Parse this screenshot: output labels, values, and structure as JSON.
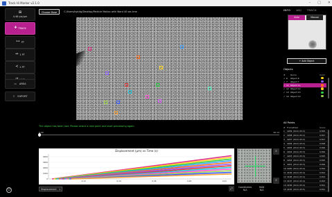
{
  "window": {
    "title": "Track Hi Marker v2.1.0",
    "controls": [
      "–",
      "□",
      "✕"
    ]
  },
  "left_toolbar": {
    "fps": "4.48 pix/µm",
    "buttons": [
      {
        "label": "TRACK",
        "icon": "plus-icon",
        "glyph": "✚",
        "active": true
      },
      {
        "label": "PT",
        "icon": "dots-icon",
        "glyph": "••",
        "active": false
      },
      {
        "label": "1 PT",
        "icon": "arrow-icon",
        "glyph": "↔",
        "active": false
      },
      {
        "label": "2 PT",
        "icon": "share-icon",
        "glyph": "≺",
        "active": false
      },
      {
        "label": "LINE",
        "icon": "line-icon",
        "glyph": "⇄",
        "active": false
      },
      {
        "label": "AREA",
        "icon": "area-icon",
        "glyph": "▭",
        "active": false
      }
    ],
    "export_label": "EXPORT"
  },
  "topbar": {
    "choose_label": "Choose Dose",
    "file_path": "C:/Users/kgh/tg/Desktop/Particle Motion with Ward 40 sec.tme"
  },
  "status": {
    "message": "The object has been lost. Please select a new point and start processing again.",
    "timeline_start": "0.00",
    "timeline_end": "40.13"
  },
  "markers": [
    {
      "color": "#e0308a"
    },
    {
      "color": "#3aa0ff"
    },
    {
      "color": "#ff6a1a"
    },
    {
      "color": "#8a5cff"
    },
    {
      "color": "#ffd21a"
    },
    {
      "color": "#2ecf4a"
    },
    {
      "color": "#e03a3a"
    },
    {
      "color": "#22c8d8"
    },
    {
      "color": "#ff4fd0"
    },
    {
      "color": "#9ad14a"
    },
    {
      "color": "#3a5cff"
    },
    {
      "color": "#ffa43a"
    },
    {
      "color": "#d45aff"
    },
    {
      "color": "#5affc8"
    }
  ],
  "chart_data": {
    "type": "line",
    "title": "Displacement (µm) vs Time (s)",
    "xlabel": "",
    "ylabel": "",
    "xlim": [
      0,
      0.21
    ],
    "ylim": [
      0,
      4500
    ],
    "x_ticks": [
      "0",
      "0.06",
      "0.12",
      "0.18",
      "0.24",
      "0.30",
      "0.36"
    ],
    "x_ticks_shown": [
      "0.12",
      "0.24",
      "0.36",
      "0.48",
      "0.21"
    ],
    "y_ticks": [
      "0",
      "1000",
      "2000",
      "3000",
      "4000"
    ],
    "series": [
      {
        "color": "#e0308a",
        "values": [
          0,
          4200
        ]
      },
      {
        "color": "#ffd21a",
        "values": [
          0,
          3900
        ]
      },
      {
        "color": "#2ecf4a",
        "values": [
          0,
          3600
        ]
      },
      {
        "color": "#3aa0ff",
        "values": [
          0,
          3300
        ]
      },
      {
        "color": "#ff6a1a",
        "values": [
          0,
          3000
        ]
      },
      {
        "color": "#8a5cff",
        "values": [
          0,
          2700
        ]
      },
      {
        "color": "#e03a3a",
        "values": [
          0,
          2400
        ]
      },
      {
        "color": "#22c8d8",
        "values": [
          0,
          2100
        ]
      },
      {
        "color": "#ff4fd0",
        "values": [
          0,
          1800
        ]
      },
      {
        "color": "#9ad14a",
        "values": [
          0,
          1500
        ]
      },
      {
        "color": "#3a5cff",
        "values": [
          0,
          1200
        ]
      },
      {
        "color": "#ffa43a",
        "values": [
          0,
          900
        ]
      }
    ]
  },
  "graph_controls": {
    "plot_select": "Displacement",
    "coordinates_label": "Coordinates",
    "coordinates_value": "N/A",
    "raw_label": "RAW",
    "raw_value": "N/A"
  },
  "right_panel": {
    "tabs": [
      "INFO",
      "ADJ",
      "TRACK"
    ],
    "mode_auto": "Auto",
    "mode_manual": "Manual",
    "add_object_label": "+ Add Object",
    "objects_title": "Objects",
    "objects_headers": [
      "#",
      "",
      "Name",
      "Color"
    ],
    "objects": [
      {
        "id": "6",
        "name": "Object 6",
        "color": "#ffd21a",
        "selected": false
      },
      {
        "id": "7",
        "name": "Object 7",
        "color": "#8a5cff",
        "selected": false
      },
      {
        "id": "11",
        "name": "Object 11",
        "color": "#ff6a1a",
        "selected": true
      },
      {
        "id": "12",
        "name": "Object 12",
        "color": "#ffd21a",
        "selected": false
      },
      {
        "id": "13",
        "name": "Object 13",
        "color": "#2ecf4a",
        "selected": false
      },
      {
        "id": "10",
        "name": "Object 10",
        "color": "#9ad14a",
        "selected": false
      }
    ],
    "points_title": "All Points",
    "points_headers": [
      "#",
      "Frame",
      "Pixel",
      "Score"
    ],
    "points": [
      {
        "n": "1",
        "frame": "4209",
        "pixel": "(94.0, 63.2)",
        "score": "0.815"
      },
      {
        "n": "2",
        "frame": "4208",
        "pixel": "(94.0, 63.2)",
        "score": "0.817"
      },
      {
        "n": "3",
        "frame": "4207",
        "pixel": "(94.0, 63.2)",
        "score": "0.817"
      },
      {
        "n": "4",
        "frame": "4206",
        "pixel": "(94.0, 63.2)",
        "score": "0.818"
      },
      {
        "n": "5",
        "frame": "4205",
        "pixel": "(94.0, 63.3)",
        "score": "0.816"
      },
      {
        "n": "6",
        "frame": "4204",
        "pixel": "(94.0, 63.3)",
        "score": "0.816"
      },
      {
        "n": "7",
        "frame": "4203",
        "pixel": "(94.0, 63.3)",
        "score": "0.815"
      },
      {
        "n": "8",
        "frame": "4202",
        "pixel": "(94.0, 63.3)",
        "score": "0.815"
      },
      {
        "n": "9",
        "frame": "4201",
        "pixel": "(94.0, 63.3)",
        "score": "0.816"
      },
      {
        "n": "10",
        "frame": "4200",
        "pixel": "(94.0, 63.4)",
        "score": "0.814"
      },
      {
        "n": "11",
        "frame": "4199",
        "pixel": "(94.0, 63.4)",
        "score": "0.814"
      },
      {
        "n": "12",
        "frame": "4198",
        "pixel": "(94.0, 63.4)",
        "score": "0.813"
      },
      {
        "n": "13",
        "frame": "4197",
        "pixel": "(94.0, 63.4)",
        "score": "0.813"
      },
      {
        "n": "14",
        "frame": "4196",
        "pixel": "(94.0, 63.4)",
        "score": "0.811"
      },
      {
        "n": "15",
        "frame": "4195",
        "pixel": "(94.0, 63.5)",
        "score": "0.811"
      }
    ]
  }
}
